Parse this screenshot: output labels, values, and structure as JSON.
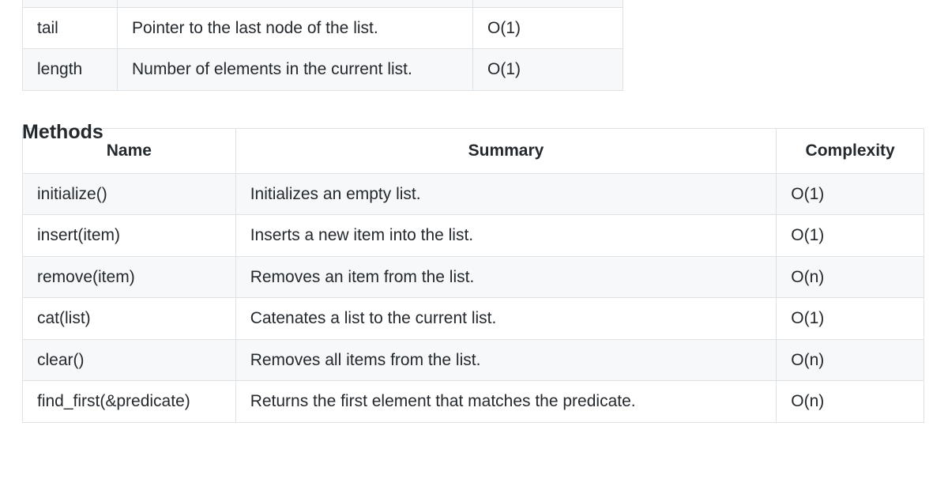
{
  "props_table": {
    "rows": [
      {
        "name": "tail",
        "summary": "Pointer to the last node of the list.",
        "complexity": "O(1)"
      },
      {
        "name": "length",
        "summary": "Number of elements in the current list.",
        "complexity": "O(1)"
      }
    ],
    "partial_above": "(·)"
  },
  "methods_heading": "Methods",
  "methods_table": {
    "headers": {
      "name": "Name",
      "summary": "Summary",
      "complexity": "Complexity"
    },
    "rows": [
      {
        "name": "initialize()",
        "summary": "Initializes an empty list.",
        "complexity": "O(1)"
      },
      {
        "name": "insert(item)",
        "summary": "Inserts a new item into the list.",
        "complexity": "O(1)"
      },
      {
        "name": "remove(item)",
        "summary": "Removes an item from the list.",
        "complexity": "O(n)"
      },
      {
        "name": "cat(list)",
        "summary": "Catenates a list to the current list.",
        "complexity": "O(1)"
      },
      {
        "name": "clear()",
        "summary": "Removes all items from the list.",
        "complexity": "O(n)"
      },
      {
        "name": "find_first(&predicate)",
        "summary": "Returns the first element that matches the predicate.",
        "complexity": "O(n)"
      }
    ]
  }
}
